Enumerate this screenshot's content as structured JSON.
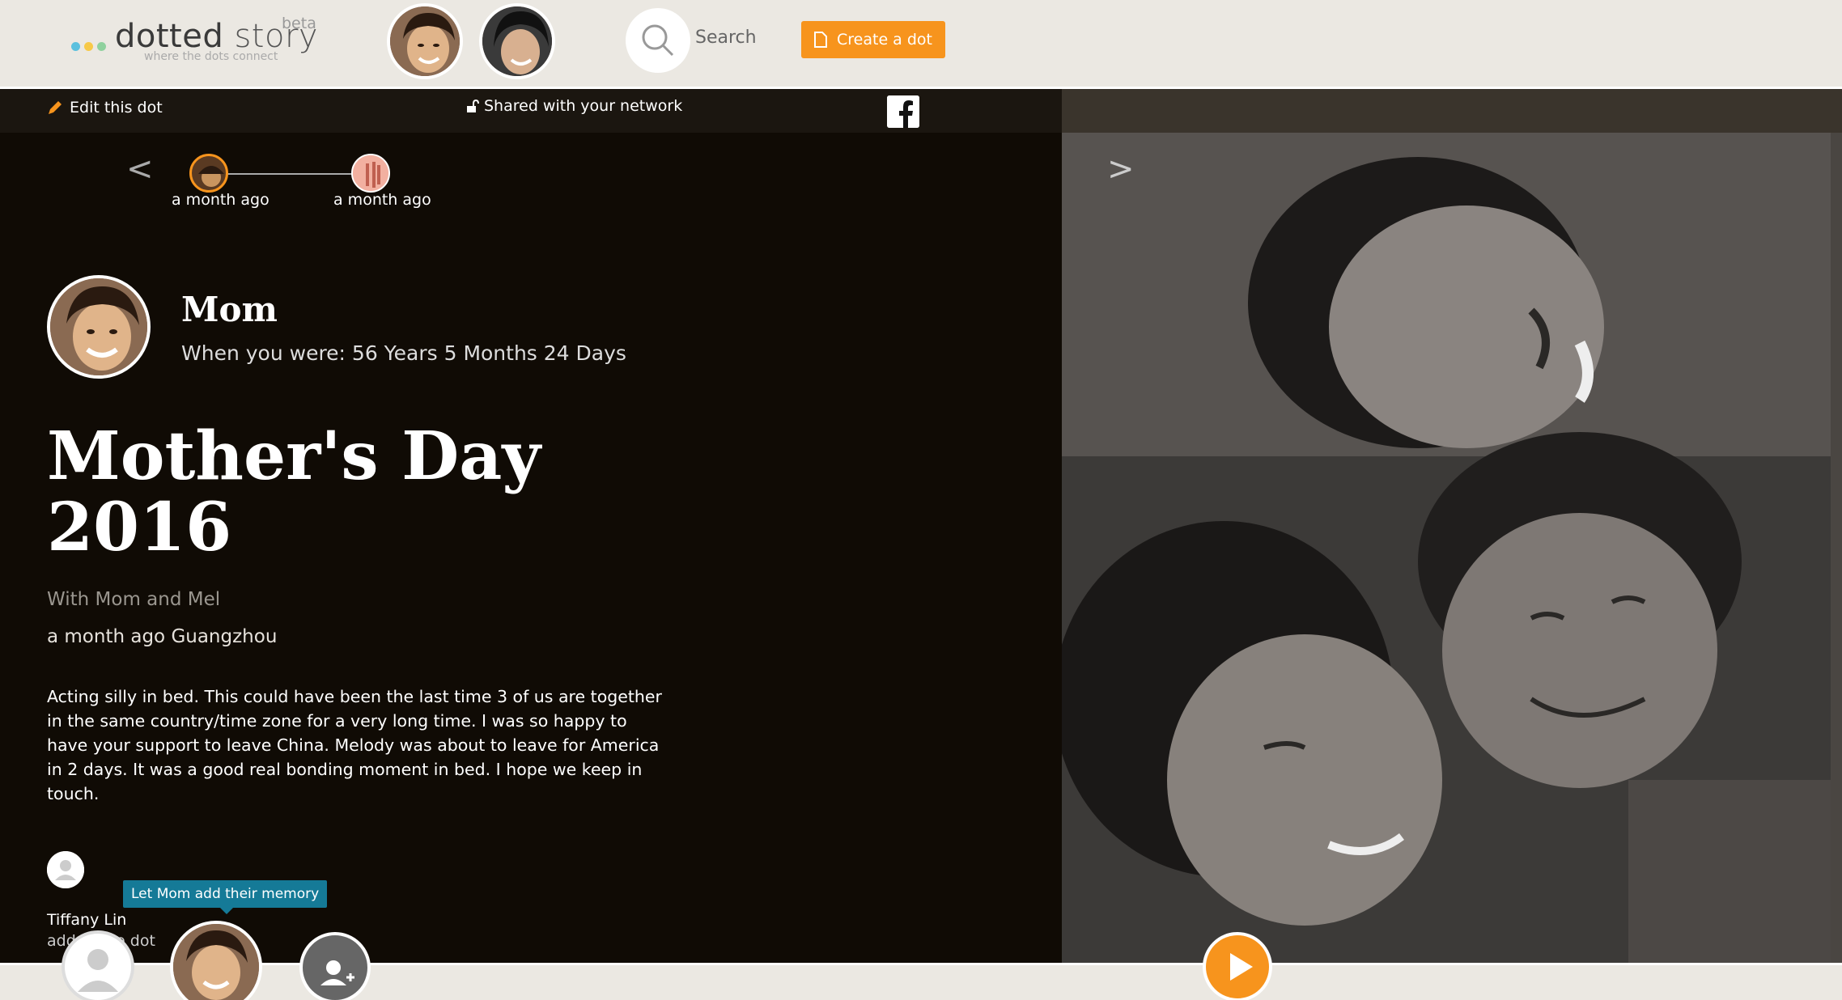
{
  "header": {
    "logo_main": "dotted",
    "logo_story": "story",
    "logo_beta": "beta",
    "logo_tagline": "where the dots connect",
    "search_label": "Search",
    "create_label": "Create a dot"
  },
  "toolbar": {
    "edit_label": "Edit this dot",
    "share_label": "Shared with your network"
  },
  "timeline": {
    "items": [
      {
        "label": "a month ago"
      },
      {
        "label": "a month ago"
      }
    ]
  },
  "person": {
    "name": "Mom",
    "age_text": "When you were: 56 Years 5 Months 24 Days"
  },
  "dot": {
    "title_line1": "Mother's Day",
    "title_line2": "2016",
    "with_text": "With Mom and Mel",
    "when_text": "a month ago Guangzhou",
    "description": "Acting silly in bed. This could have been the last time 3 of us are together in the same country/time zone for a very long time. I was so happy to have your support to leave China. Melody was about to leave for America in 2 days. It was a good real bonding moment in bed. I hope we keep in touch."
  },
  "contributor": {
    "name": "Tiffany Lin",
    "action": "added the dot",
    "tooltip": "Let Mom add their memory"
  },
  "colors": {
    "accent": "#f7941d",
    "tooltip": "#157a97",
    "dark_bg": "#100b05",
    "header_bg": "#ebe8e2"
  }
}
